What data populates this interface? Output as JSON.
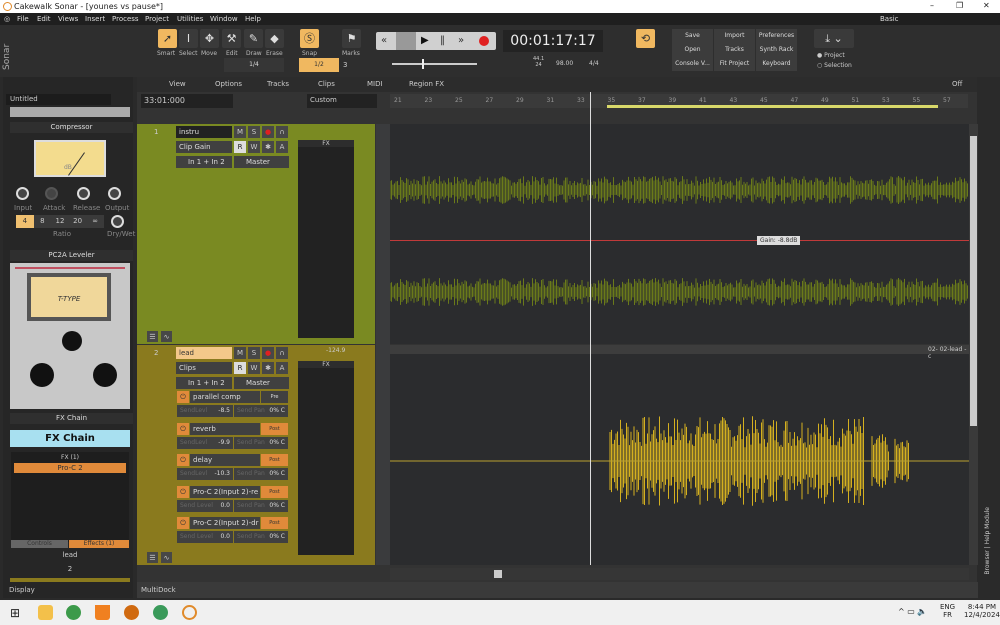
{
  "window": {
    "title": "Cakewalk Sonar - [younes vs pause*]",
    "workspace": "Basic"
  },
  "menu": [
    "File",
    "Edit",
    "Views",
    "Insert",
    "Process",
    "Project",
    "Utilities",
    "Window",
    "Help"
  ],
  "brand": "Sonar",
  "tools": [
    {
      "label": "Smart",
      "icon": "arrow-icon",
      "active": true
    },
    {
      "label": "Select",
      "icon": "ibeam-icon"
    },
    {
      "label": "Move",
      "icon": "move-icon"
    },
    {
      "label": "Edit",
      "icon": "wrench-icon"
    },
    {
      "label": "Draw",
      "icon": "pencil-icon"
    },
    {
      "label": "Erase",
      "icon": "eraser-icon"
    }
  ],
  "tool_resolution": "1/4",
  "snap": {
    "label": "Snap",
    "value": "1/2",
    "marks_label": "Marks",
    "marks_value": "3"
  },
  "transport": {
    "time": "00:01:17:17",
    "sample_rate": "44.1",
    "bit_depth": "24",
    "tempo": "98.00",
    "meter": "4/4"
  },
  "buttons": [
    "Save",
    "Import",
    "Preferences",
    "Open",
    "Tracks",
    "Synth Rack",
    "Console V...",
    "Fit Project",
    "Keyboard"
  ],
  "export": {
    "project": "Project",
    "selection": "Selection"
  },
  "trackview_menu": [
    "View",
    "Options",
    "Tracks",
    "Clips",
    "MIDI",
    "Region FX"
  ],
  "now_field": "33:01:000",
  "preset": "Custom",
  "snap_off": "Off",
  "ruler": [
    "21",
    "23",
    "25",
    "27",
    "29",
    "31",
    "33",
    "35",
    "37",
    "39",
    "41",
    "43",
    "45",
    "47",
    "49",
    "51",
    "53",
    "55",
    "57"
  ],
  "inspector": {
    "name": "Untitled",
    "compressor": {
      "title": "Compressor",
      "knobs": [
        "Input",
        "Attack",
        "Release",
        "Output"
      ],
      "ratios": [
        "4",
        "8",
        "12",
        "20",
        "∞"
      ],
      "ratio_label": "Ratio",
      "drywet": "Dry/Wet",
      "meter_unit": "dB"
    },
    "pc2a": {
      "title": "PC2A Leveler",
      "brand": "T-TYPE"
    },
    "fxchain": {
      "title": "FX Chain",
      "button": "FX Chain",
      "fx_header": "FX (1)",
      "fx": [
        "Pro-C 2"
      ],
      "tabs": [
        "Controls",
        "Effects (1)"
      ],
      "track": "lead",
      "number": "2"
    },
    "display": "Display"
  },
  "tracks": [
    {
      "number": "1",
      "name": "instru",
      "mode": "Clip Gain",
      "input": "In 1 + In 2",
      "output": "Master",
      "color": "#7a8a22",
      "fx": "FX",
      "gain_tip": "Gain: -8.8dB"
    },
    {
      "number": "2",
      "name": "lead",
      "mode": "Clips",
      "input": "In 1 + In 2",
      "output": "Master",
      "color": "#8a7a1e",
      "fx": "FX",
      "peak": "-124.9",
      "clip_label": "02- 02-lead -c",
      "sends": [
        {
          "name": "parallel comp",
          "mode": "Pre",
          "level_label": "SendLevl",
          "level": "-8.5",
          "pan_label": "Send Pan",
          "pan": "0% C"
        },
        {
          "name": "reverb",
          "mode": "Post",
          "level_label": "SendLevl",
          "level": "-9.9",
          "pan_label": "Send Pan",
          "pan": "0% C"
        },
        {
          "name": "delay",
          "mode": "Post",
          "level_label": "SendLevl",
          "level": "-10.3",
          "pan_label": "Send Pan",
          "pan": "0% C"
        },
        {
          "name": "Pro-C 2(Input 2)-re",
          "mode": "Post",
          "level_label": "Send Level",
          "level": "0.0",
          "pan_label": "Send Pan",
          "pan": "0% C"
        },
        {
          "name": "Pro-C 2(Input 2)-dr",
          "mode": "Post",
          "level_label": "Send Level",
          "level": "0.0",
          "pan_label": "Send Pan",
          "pan": "0% C"
        }
      ]
    }
  ],
  "track_buttons": {
    "m": "M",
    "s": "S",
    "r": "R",
    "w": "W",
    "a": "A"
  },
  "multidock": "MultiDock",
  "right_sidebar": "Browser | Help Module",
  "tray": {
    "lang1": "ENG",
    "lang2": "FR",
    "time": "8:44 PM",
    "date": "12/4/2024"
  }
}
